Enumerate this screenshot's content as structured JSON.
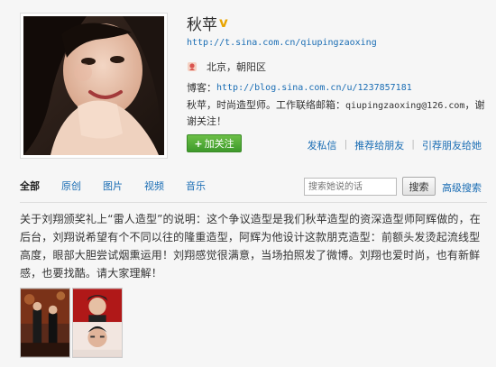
{
  "profile": {
    "name": "秋苹",
    "verified_mark": "v",
    "weibo_url": "http://t.sina.com.cn/qiupingzaoxing",
    "location": "北京，朝阳区",
    "blog_label": "博客：",
    "blog_url": "http://blog.sina.com.cn/u/1237857181",
    "bio_prefix": "秋苹，时尚造型师。工作联络邮箱：",
    "bio_email": "qiupingzaoxing@126.com",
    "bio_suffix": "，谢谢关注！"
  },
  "follow_button": {
    "plus": "+",
    "label": "加关注"
  },
  "actions": [
    "发私信",
    "推荐给朋友",
    "引荐朋友给她"
  ],
  "tabs": [
    {
      "label": "全部",
      "active": true
    },
    {
      "label": "原创"
    },
    {
      "label": "图片"
    },
    {
      "label": "视频"
    },
    {
      "label": "音乐"
    }
  ],
  "search": {
    "placeholder": "搜索她说的话",
    "button_label": "搜索",
    "advanced_label": "高级搜索"
  },
  "post": {
    "text": "关于刘翔颁奖礼上“雷人造型”的说明：这个争议造型是我们秋苹造型的资深造型师阿辉做的，在后台，刘翔说希望有个不同以往的隆重造型，阿辉为他设计这款朋克造型：前额头发烫起流线型高度，眼部大胆尝试烟熏运用！刘翔感觉很满意，当场拍照发了微博。刘翔也爱时尚，也有新鲜感，也要找酷。请大家理解！"
  },
  "icons": {
    "location": "location-pin-icon",
    "verified": "verified-badge-icon"
  }
}
